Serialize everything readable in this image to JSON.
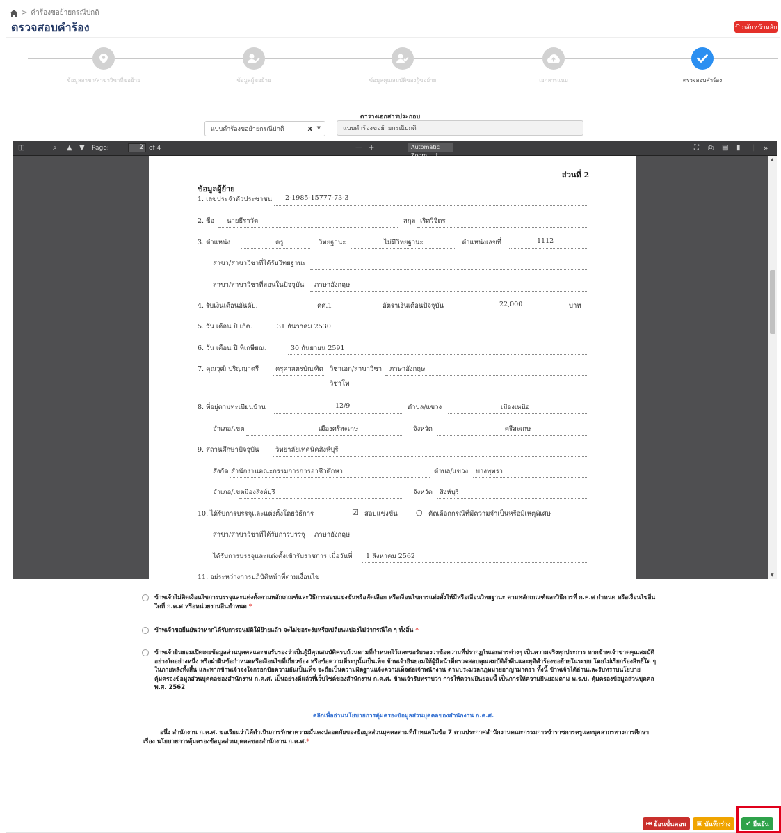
{
  "breadcrumb": {
    "separator": ">",
    "current": "คำร้องขอย้ายกรณีปกติ"
  },
  "page_title": "ตรวจสอบคำร้อง",
  "back_home_label": "กลับหน้าหลัก",
  "steps": [
    {
      "label": "ข้อมูลสาขา/สาขาวิชาที่ขอย้าย",
      "icon": "map-marker-icon",
      "state": "inactive"
    },
    {
      "label": "ข้อมูลผู้ขอย้าย",
      "icon": "user-edit-icon",
      "state": "inactive"
    },
    {
      "label": "ข้อมูลคุณสมบัติของผู้ขอย้าย",
      "icon": "user-check-icon",
      "state": "inactive"
    },
    {
      "label": "เอกสารแนบ",
      "icon": "cloud-upload-icon",
      "state": "inactive"
    },
    {
      "label": "ตรวจสอบคำร้อง",
      "icon": "check-icon",
      "state": "active"
    }
  ],
  "documents": {
    "caption": "ตารางเอกสารประกอบ",
    "selected": "แบบคำร้องขอย้ายกรณีปกติ",
    "clear": "x",
    "preview_name": "แบบคำร้องขอย้ายกรณีปกติ"
  },
  "pdf_toolbar": {
    "page_label": "Page:",
    "page_value": "2",
    "page_total": "of 4",
    "zoom_minus": "—",
    "zoom_plus": "+",
    "zoom_value": "Automatic Zoom",
    "more": "»"
  },
  "pdf": {
    "section_no": "ส่วนที่ 2",
    "heading": "ข้อมูลผู้ย้าย",
    "lines": {
      "l1_label": "1.   เลขประจำตัวประชาชน",
      "l1_value": "2-1985-15777-73-3",
      "l2_label": "2.   ชื่อ",
      "l2_name": "นายธีราวัต",
      "l2_surname_label": "สกุล",
      "l2_surname": "เริศวิจิตร",
      "l3_label": "3.   ตำแหน่ง",
      "l3_position": "ครู",
      "l3_rank_label": "วิทยฐานะ",
      "l3_rank": "ไม่มีวิทยฐานะ",
      "l3_posno_label": "ตำแหน่งเลขที่",
      "l3_posno": "1112",
      "l3b_label": "สาขา/สาขาวิชาที่ได้รับวิทยฐานะ",
      "l3c_label": "สาขา/สาขาวิชาที่สอนในปัจจุบัน",
      "l3c_value": "ภาษาอังกฤษ",
      "l4_label": "4.   รับเงินเดือนอันดับ.",
      "l4_grade": "คศ.1",
      "l4_salary_label": "อัตราเงินเดือนปัจจุบัน",
      "l4_salary": "22,000",
      "l4_unit": "บาท",
      "l5_label": "5.   วัน เดือน ปี เกิด.",
      "l5_value": "31 ธันวาคม 2530",
      "l6_label": "6.   วัน เดือน ปี ที่เกษียณ.",
      "l6_value": "30 กันยายน 2591",
      "l7_label": "7.   คุณวุฒิ  ปริญญาตรี",
      "l7_degree": "ครุศาสตรบัณฑิต",
      "l7_major_label": "วิชาเอก/สาขาวิชา",
      "l7_major": "ภาษาอังกฤษ",
      "l7_minor_label": "วิชาโท",
      "l8_label": "8.   ที่อยู่ตามทะเบียนบ้าน",
      "l8_no": "12/9",
      "l8_sub_label": "ตำบล/แขวง",
      "l8_sub": "เมืองเหนือ",
      "l8_dist_label": "อำเภอ/เขต",
      "l8_dist": "เมืองศรีสะเกษ",
      "l8_prov_label": "จังหวัด",
      "l8_prov": "ศรีสะเกษ",
      "l9_label": "9.   สถานศึกษาปัจจุบัน",
      "l9_school": "วิทยาลัยเทคนิคสิงห์บุรี",
      "l9_aff_label": "สังกัด",
      "l9_aff": "สำนักงานคณะกรรมการการอาชีวศึกษา",
      "l9_sub_label": "ตำบล/แขวง",
      "l9_sub": "บางพุทรา",
      "l9_dist_label": "อำเภอ/เขต",
      "l9_dist": "เมืองสิงห์บุรี",
      "l9_prov_label": "จังหวัด",
      "l9_prov": "สิงห์บุรี",
      "l10_label": "10.   ได้รับการบรรจุและแต่งตั้งโดยวิธีการ",
      "l10_opt1": "สอบแข่งขัน",
      "l10_opt2": "คัดเลือกกรณีที่มีความจำเป็นหรือมีเหตุพิเศษ",
      "l10b_label": "สาขา/สาขาวิชาที่ได้รับการบรรจุ",
      "l10b_value": "ภาษาอังกฤษ",
      "l10c_label": "ได้รับการบรรจุและแต่งตั้งเข้ารับราชการ  เมื่อวันที่",
      "l10c_value": "1 สิงหาคม 2562",
      "l11_label": "11.   อยู่ระหว่างการปฏิบัติหน้าที่ตามเงื่อนไข"
    }
  },
  "consents": [
    {
      "text": "ข้าพเจ้าไม่ติดเงื่อนไขการบรรจุและแต่งตั้งตามหลักเกณฑ์และวิธีการสอบแข่งขันหรือคัดเลือก หรือเงื่อนไขการแต่งตั้งให้มีหรือเลื่อนวิทยฐานะ ตามหลักเกณฑ์และวิธีการที่ ก.ค.ศ กำหนด หรือเงื่อนไขอื่นใดที่ ก.ค.ศ หรือหน่วยงานอื่นกำหนด",
      "req": "*"
    },
    {
      "text": "ข้าพเจ้าขอยืนยันว่าหากได้รับการอนุมัติให้ย้ายแล้ว จะไม่ขอระงับหรือเปลี่ยนแปลงไม่ว่ากรณีใด ๆ ทั้งสิ้น",
      "req": "*"
    },
    {
      "text": "ข้าพเจ้ายินยอมเปิดเผยข้อมูลส่วนบุคคลและขอรับรองว่าเป็นผู้มีคุณสมบัติครบถ้วนตามที่กำหนดไว้และขอรับรองว่าข้อความที่ปรากฏในเอกสารต่างๆ เป็นความจริงทุกประการ หากข้าพเจ้าขาดคุณสมบัติอย่างใดอย่างหนึ่ง หรือฝ่าฝืนข้อกำหนดหรือเงื่อนไขที่เกี่ยวข้อง หรือข้อความที่ระบุนั้นเป็นเท็จ ข้าพเจ้ายินยอมให้ผู้มีหน้าที่ตรวจสอบคุณสมบัติสั่งคืนและยุติคำร้องขอย้ายในระบบ โดยไม่เรียกร้องสิทธิ์ใด ๆ ในภายหลังทั้งสิ้น และหากข้าพเจ้าจงใจกรอกข้อความอันเป็นเท็จ จะถือเป็นความผิดฐานแจ้งความเท็จต่อเจ้าพนักงาน ตามประมวลกฎหมายอาญามาตรา ทั้งนี้ ข้าพเจ้าได้อ่านและรับทราบนโยบายคุ้มครองข้อมูลส่วนบุคคลของสำนักงาน ก.ค.ศ. เป็นอย่างดีแล้วที่เว็บไซต์ของสำนักงาน ก.ค.ศ. ข้าพเจ้ารับทราบว่า การให้ความยินยอมนี้ เป็นการให้ความยินยอมตาม พ.ร.บ. คุ้มครองข้อมูลส่วนบุคคล พ.ศ. 2562",
      "req": ""
    }
  ],
  "policy_link": "คลิกเพื่ออ่านนโยบายการคุ้มครองข้อมูลส่วนบุคคลของสำนักงาน ก.ค.ศ.",
  "policy_text": "อนึ่ง สำนักงาน ก.ค.ศ. ขอเรียนว่าได้ดำเนินการรักษาความมั่นคงปลอดภัยของข้อมูลส่วนบุคคลตามที่กำหนดในข้อ 7 ตามประกาศสำนักงานคณะกรรมการข้าราชการครูและบุคลากรทางการศึกษา เรื่อง นโยบายการคุ้มครองข้อมูลส่วนบุคคลของสำนักงาน ก.ค.ศ.",
  "policy_req": "*",
  "footer": {
    "back_step": "ย้อนขั้นตอน",
    "save_draft": "บันทึกร่าง",
    "confirm": "ยืนยัน"
  },
  "colors": {
    "primary": "#2b8ff1",
    "danger": "#e4302a",
    "warning": "#f0a400",
    "success": "#2ea24a",
    "title": "#253a66"
  }
}
